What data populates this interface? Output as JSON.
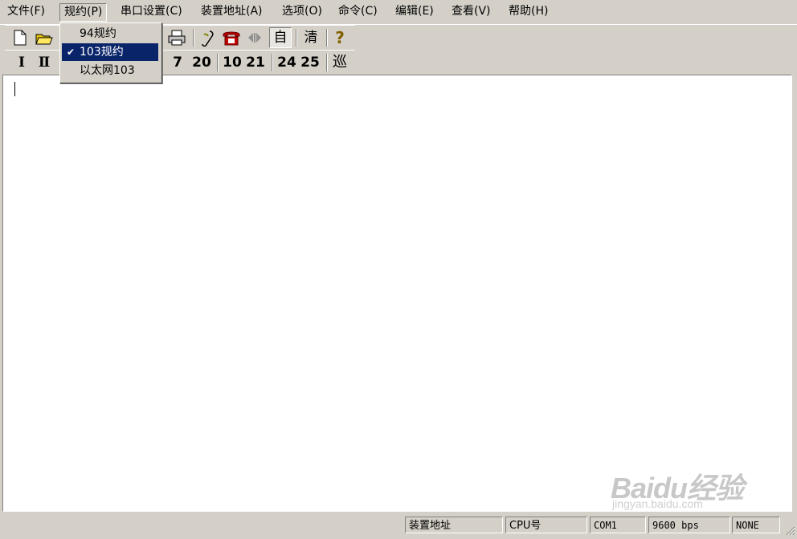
{
  "menubar": {
    "items": [
      {
        "label": "文件(F)"
      },
      {
        "label": "规约(P)"
      },
      {
        "label": "串口设置(C)"
      },
      {
        "label": "装置地址(A)"
      },
      {
        "label": "选项(O)"
      },
      {
        "label": "命令(C)"
      },
      {
        "label": "编辑(E)"
      },
      {
        "label": "查看(V)"
      },
      {
        "label": "帮助(H)"
      }
    ]
  },
  "protocol_menu": {
    "items": [
      {
        "label": "94规约",
        "checked": false
      },
      {
        "label": "103规约",
        "checked": true
      },
      {
        "label": "以太网103",
        "checked": false
      }
    ],
    "check_mark": "✔"
  },
  "toolbar1": {
    "auto_label": "自",
    "clear_label": "清",
    "help_label": "?"
  },
  "toolbar2": {
    "buttons": [
      "Ⅰ",
      "Ⅱ",
      "7",
      "20",
      "10",
      "21",
      "24",
      "25",
      "巡"
    ]
  },
  "statusbar": {
    "device_address": "装置地址",
    "cpu": "CPU号",
    "port": "COM1",
    "baud": "9600 bps",
    "parity": "NONE"
  },
  "watermark": {
    "brand": "Baidu经验",
    "url": "jingyan.baidu.com"
  },
  "colors": {
    "chrome": "#d4d0c8",
    "highlight": "#0a246a",
    "editor_bg": "#ffffff"
  }
}
